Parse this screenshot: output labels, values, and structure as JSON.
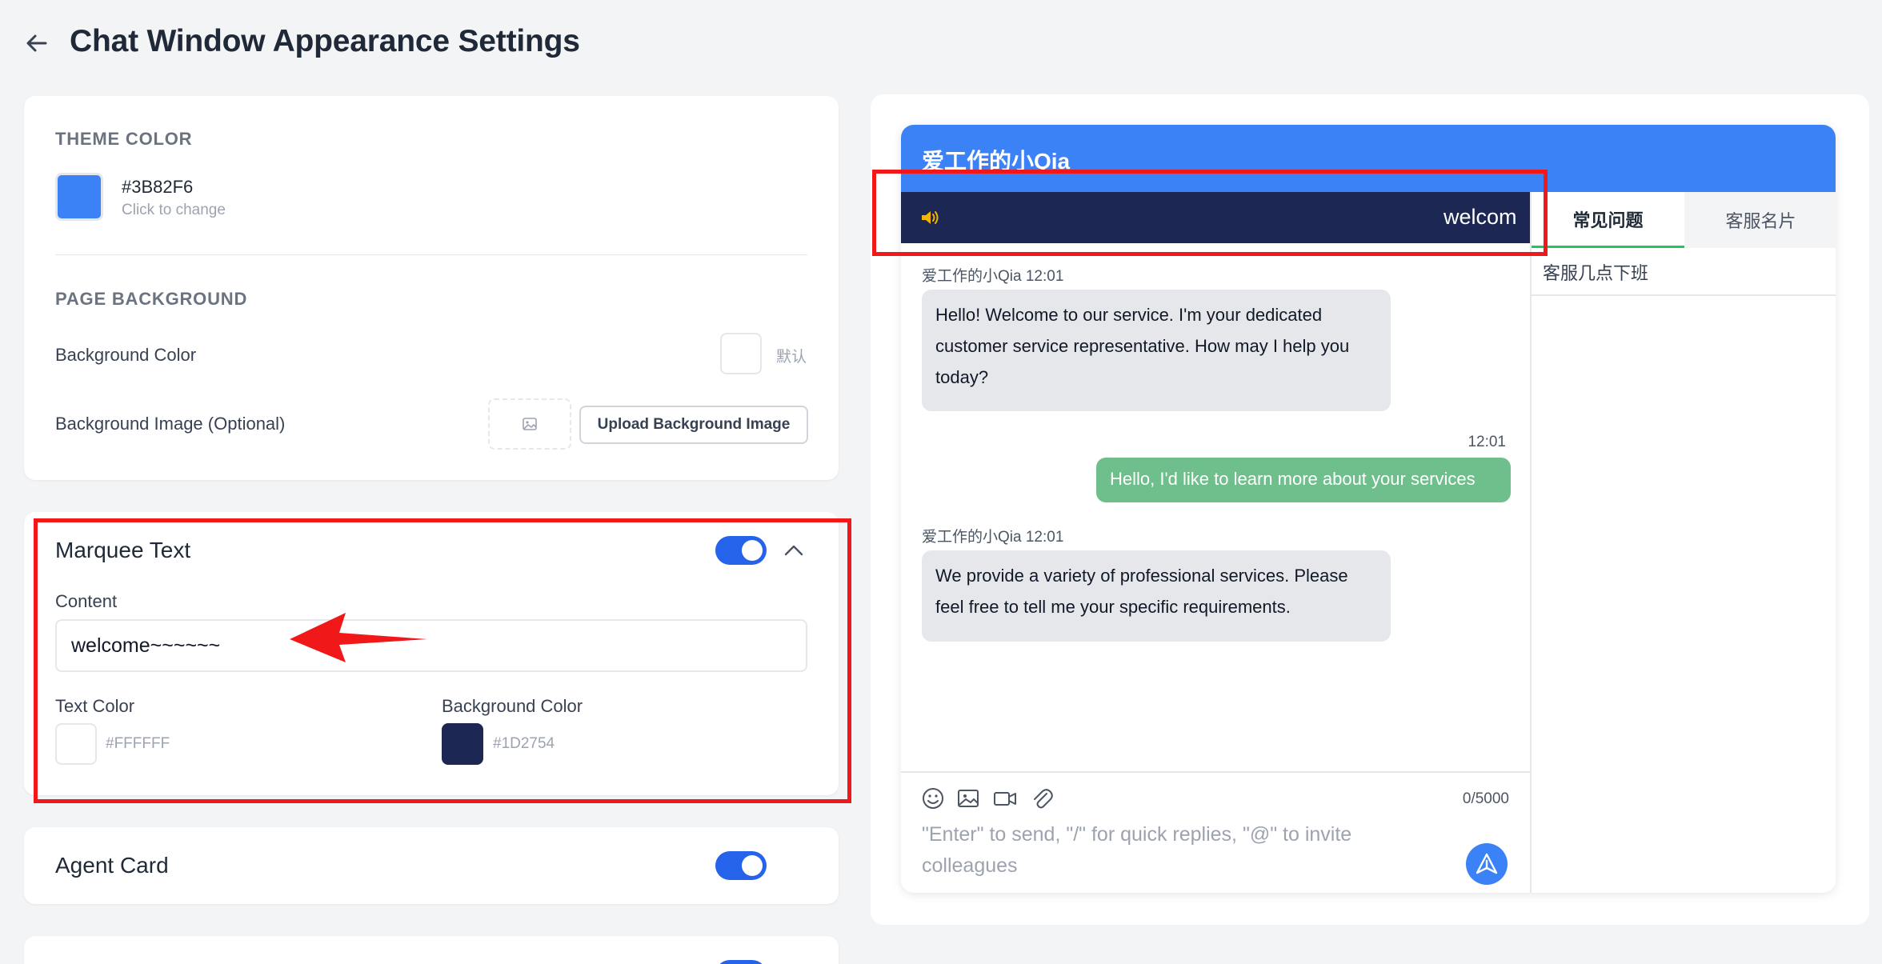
{
  "header": {
    "title": "Chat Window Appearance Settings",
    "back_icon": "arrow-left-icon"
  },
  "theme": {
    "section_label": "THEME COLOR",
    "color_hex": "#3B82F6",
    "hint": "Click to change"
  },
  "page_background": {
    "section_label": "PAGE BACKGROUND",
    "bg_color_label": "Background Color",
    "bg_color_value": "默认",
    "bg_image_label": "Background Image (Optional)",
    "upload_label": "Upload Background Image"
  },
  "marquee": {
    "title": "Marquee Text",
    "enabled": true,
    "content_label": "Content",
    "content_value": "welcome~~~~~~",
    "text_color_label": "Text Color",
    "text_color_hex": "#FFFFFF",
    "bg_color_label": "Background Color",
    "bg_color_hex": "#1D2754"
  },
  "agent_card": {
    "title": "Agent Card",
    "enabled": true
  },
  "preview": {
    "chat_title": "爱工作的小Qia",
    "header_color": "#3B82F6",
    "marquee_visible_text": "welcom",
    "messages": [
      {
        "direction": "in",
        "sender_line": "爱工作的小Qia 12:01",
        "text": "Hello! Welcome to our service. I'm your dedicated customer service representative. How may I help you today?"
      },
      {
        "direction": "out",
        "time": "12:01",
        "text": "Hello, I'd like to learn more about your services"
      },
      {
        "direction": "in",
        "sender_line": "爱工作的小Qia 12:01",
        "text": "We provide a variety of professional services. Please feel free to tell me your specific requirements."
      }
    ],
    "tabs": [
      {
        "label": "常见问题",
        "active": true
      },
      {
        "label": "客服名片",
        "active": false
      }
    ],
    "faq_items": [
      "客服几点下班"
    ],
    "composer": {
      "placeholder": "\"Enter\" to send, \"/\" for quick replies, \"@\" to invite colleagues",
      "counter": "0/5000",
      "tools": [
        "emoji-icon",
        "image-icon",
        "video-icon",
        "attachment-icon"
      ]
    }
  },
  "annotation_colors": {
    "frame": "#F01818",
    "arrow": "#F01818"
  }
}
